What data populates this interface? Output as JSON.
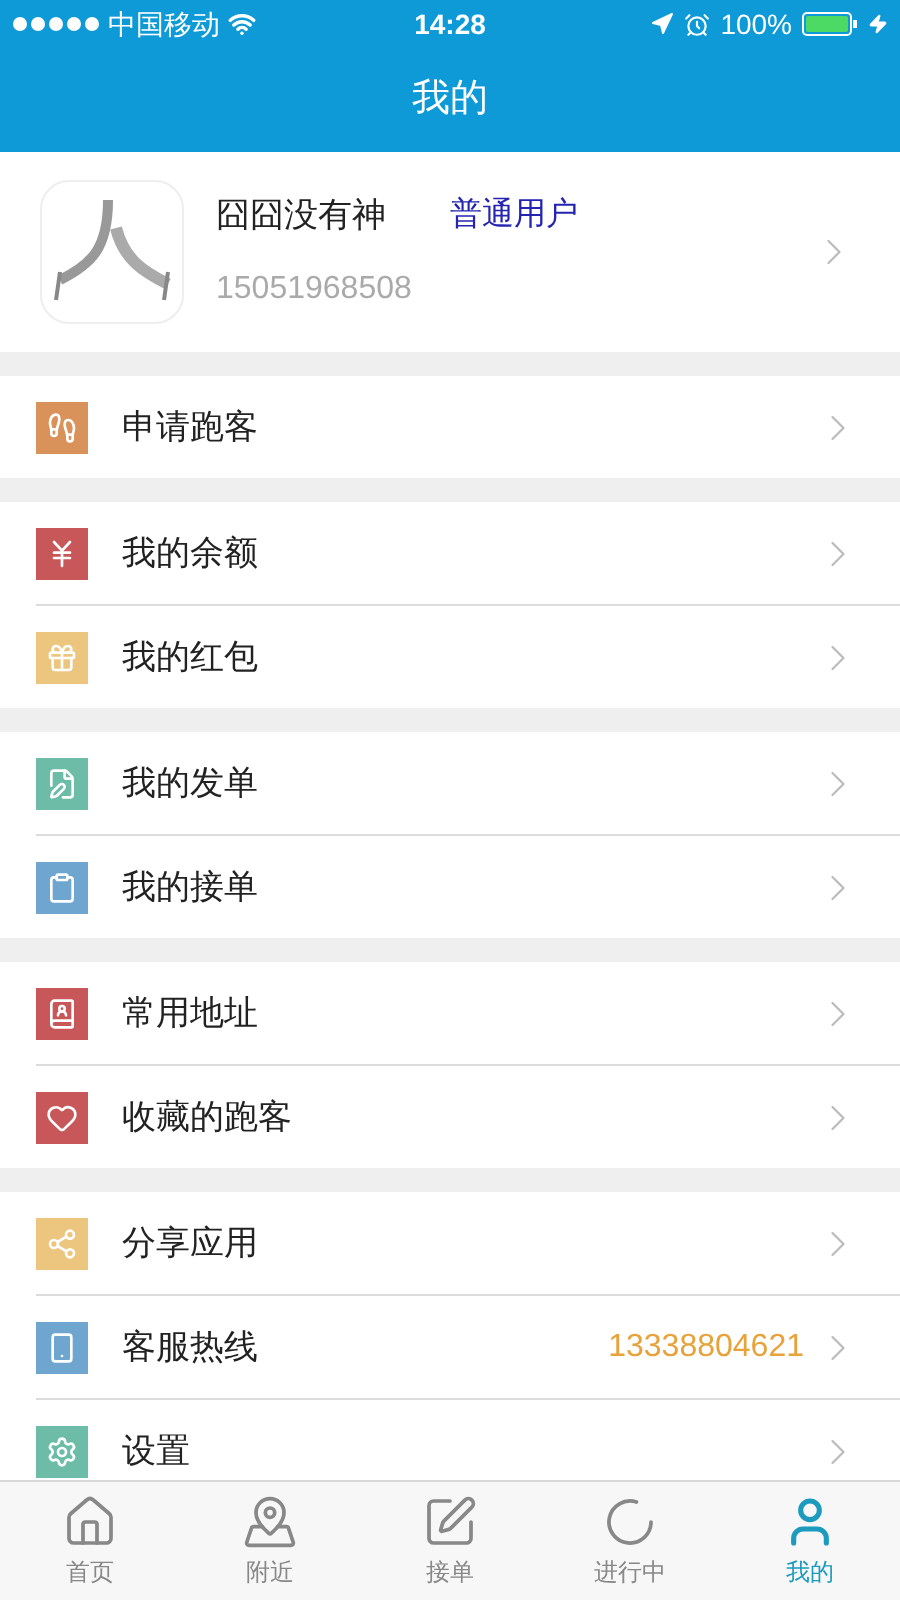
{
  "status_bar": {
    "carrier": "中国移动",
    "time": "14:28",
    "battery": "100%"
  },
  "header": {
    "title": "我的"
  },
  "profile": {
    "name": "囧囧没有神",
    "role": "普通用户",
    "phone": "15051968508"
  },
  "groups": [
    {
      "items": [
        {
          "label": "申请跑客",
          "color": "#d9925a"
        }
      ]
    },
    {
      "items": [
        {
          "label": "我的余额",
          "color": "#c8575a"
        },
        {
          "label": "我的红包",
          "color": "#ecc67e"
        }
      ]
    },
    {
      "items": [
        {
          "label": "我的发单",
          "color": "#6cbca8"
        },
        {
          "label": "我的接单",
          "color": "#6fa6cf"
        }
      ]
    },
    {
      "items": [
        {
          "label": "常用地址",
          "color": "#c8575a"
        },
        {
          "label": "收藏的跑客",
          "color": "#c8575a"
        }
      ]
    },
    {
      "items": [
        {
          "label": "分享应用",
          "color": "#ecc67e"
        },
        {
          "label": "客服热线",
          "color": "#6fa6cf",
          "value": "13338804621"
        },
        {
          "label": "设置",
          "color": "#6cbca8"
        }
      ]
    }
  ],
  "tabs": [
    {
      "label": "首页",
      "selected": false
    },
    {
      "label": "附近",
      "selected": false
    },
    {
      "label": "接单",
      "selected": false
    },
    {
      "label": "进行中",
      "selected": false
    },
    {
      "label": "我的",
      "selected": true
    }
  ]
}
